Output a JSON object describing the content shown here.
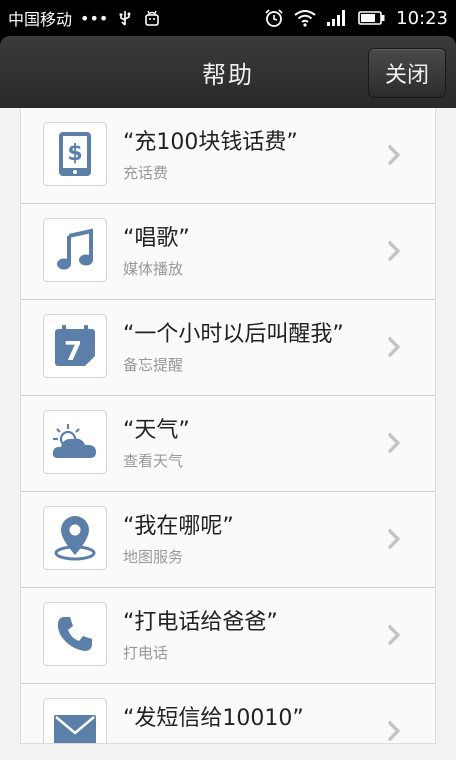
{
  "status": {
    "carrier": "中国移动",
    "dots": "•••",
    "time": "10:23"
  },
  "header": {
    "title": "帮助",
    "close_label": "关闭"
  },
  "items": [
    {
      "title": "“充100块钱话费”",
      "subtitle": "充话费",
      "icon": "phone-dollar-icon"
    },
    {
      "title": "“唱歌”",
      "subtitle": "媒体播放",
      "icon": "music-note-icon"
    },
    {
      "title": "“一个小时以后叫醒我”",
      "subtitle": "备忘提醒",
      "icon": "calendar-icon",
      "calendar_day": "7"
    },
    {
      "title": "“天气”",
      "subtitle": "查看天气",
      "icon": "weather-icon"
    },
    {
      "title": "“我在哪呢”",
      "subtitle": "地图服务",
      "icon": "location-pin-icon"
    },
    {
      "title": "“打电话给爸爸”",
      "subtitle": "打电话",
      "icon": "phone-handset-icon"
    },
    {
      "title": "“发短信给10010”",
      "subtitle": "",
      "icon": "envelope-icon"
    }
  ],
  "colors": {
    "icon_blue": "#5b7fa8",
    "chevron": "#c4c4c4"
  }
}
